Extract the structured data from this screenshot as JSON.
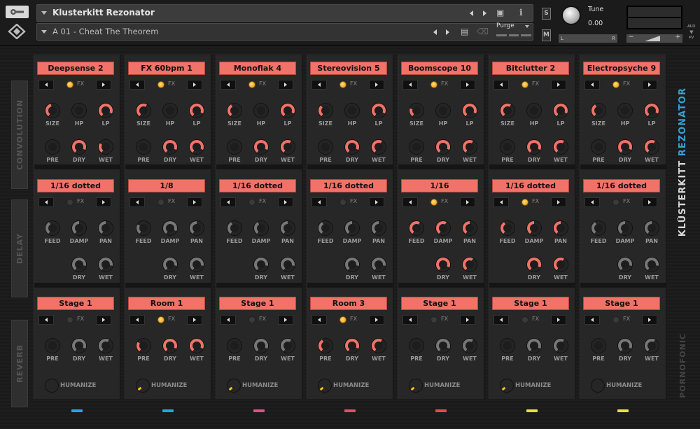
{
  "instrument": {
    "title": "Klusterkitt Rezonator",
    "preset": "A 01 - Cheat The Theorem"
  },
  "header": {
    "purge_label": "Purge",
    "solo_label": "S",
    "mute_label": "M",
    "tune_label": "Tune",
    "tune_value": "0.00",
    "pan_left": "L",
    "pan_right": "R",
    "vol_minus": "−",
    "vol_plus": "+",
    "aux_label": "AUX",
    "pv_label": "PV"
  },
  "section_labels": [
    "CONVOLUTION",
    "DELAY",
    "REVERB"
  ],
  "brand": {
    "product_a": "KLÜSTERKITT",
    "product_b": "REZONATOR",
    "vendor": "PORNOFONIC"
  },
  "fx_label": "FX",
  "knob_labels": {
    "size": "SIZE",
    "hp": "HP",
    "lp": "LP",
    "pre": "PRE",
    "dry": "DRY",
    "wet": "WET",
    "feed": "FEED",
    "damp": "DAMP",
    "pan": "PAN"
  },
  "humanize_label": "HUMANIZE",
  "colors": {
    "accent": "#f07268",
    "knob_active": "#f07268",
    "knob_inactive": "#777777",
    "led_on": "#f2a825",
    "brand_blue": "#3a9fd0"
  },
  "columns": [
    {
      "conv": {
        "name": "Deepsense 2",
        "fx": true,
        "size": 0.45,
        "hp": 0.0,
        "lp": 0.9,
        "pre": 0.0,
        "dry": 0.9,
        "wet": 0.3
      },
      "delay": {
        "name": "1/16 dotted",
        "fx": false,
        "active": false,
        "feed": 0.4,
        "damp": 0.5,
        "pan": 0.5,
        "dry": 0.0,
        "wet": 0.0
      },
      "reverb": {
        "name": "Stage 1",
        "fx": false,
        "active": false,
        "pre": 0.0,
        "dry": 0.9,
        "wet": 0.6
      },
      "humanize": 0.0,
      "indicator": "#1fa8e0"
    },
    {
      "conv": {
        "name": "FX 60bpm 1",
        "fx": true,
        "size": 0.6,
        "hp": 0.0,
        "lp": 0.9,
        "pre": 0.0,
        "dry": 0.9,
        "wet": 0.9
      },
      "delay": {
        "name": "1/8",
        "fx": false,
        "active": false,
        "feed": 0.3,
        "damp": 0.9,
        "pan": 0.5,
        "dry": 0.0,
        "wet": 0.0
      },
      "reverb": {
        "name": "Room 1",
        "fx": true,
        "active": true,
        "pre": 0.3,
        "dry": 0.9,
        "wet": 0.9
      },
      "humanize": 0.3,
      "indicator": "#1fa8e0"
    },
    {
      "conv": {
        "name": "Monoflak 4",
        "fx": true,
        "size": 0.4,
        "hp": 0.0,
        "lp": 0.9,
        "pre": 0.0,
        "dry": 0.9,
        "wet": 0.6
      },
      "delay": {
        "name": "1/16 dotted",
        "fx": false,
        "active": false,
        "feed": 0.4,
        "damp": 0.4,
        "pan": 0.5,
        "dry": 0.0,
        "wet": 0.0
      },
      "reverb": {
        "name": "Stage 1",
        "fx": false,
        "active": false,
        "pre": 0.0,
        "dry": 0.9,
        "wet": 0.6
      },
      "humanize": 0.3,
      "indicator": "#e84a8a"
    },
    {
      "conv": {
        "name": "Stereovision 5",
        "fx": true,
        "size": 0.35,
        "hp": 0.0,
        "lp": 0.9,
        "pre": 0.0,
        "dry": 0.9,
        "wet": 0.6
      },
      "delay": {
        "name": "1/16 dotted",
        "fx": false,
        "active": false,
        "feed": 0.4,
        "damp": 0.5,
        "pan": 0.5,
        "dry": 0.0,
        "wet": 0.0
      },
      "reverb": {
        "name": "Room 3",
        "fx": true,
        "active": true,
        "pre": 0.4,
        "dry": 0.9,
        "wet": 0.6
      },
      "humanize": 0.3,
      "indicator": "#e84a6a"
    },
    {
      "conv": {
        "name": "Boomscope 10",
        "fx": true,
        "size": 0.25,
        "hp": 0.0,
        "lp": 0.9,
        "pre": 0.0,
        "dry": 0.9,
        "wet": 0.6
      },
      "delay": {
        "name": "1/16",
        "fx": true,
        "active": true,
        "feed": 0.6,
        "damp": 0.6,
        "pan": 0.5,
        "dry": 0.9,
        "wet": 0.6
      },
      "reverb": {
        "name": "Stage 1",
        "fx": false,
        "active": false,
        "pre": 0.0,
        "dry": 0.9,
        "wet": 0.6
      },
      "humanize": 0.3,
      "indicator": "#e84a4a"
    },
    {
      "conv": {
        "name": "Bitclutter 2",
        "fx": true,
        "size": 0.6,
        "hp": 0.0,
        "lp": 0.9,
        "pre": 0.0,
        "dry": 0.9,
        "wet": 0.6
      },
      "delay": {
        "name": "1/16 dotted",
        "fx": true,
        "active": true,
        "feed": 0.4,
        "damp": 0.5,
        "pan": 0.5,
        "dry": 0.9,
        "wet": 0.6
      },
      "reverb": {
        "name": "Stage 1",
        "fx": false,
        "active": false,
        "pre": 0.0,
        "dry": 0.9,
        "wet": 0.6
      },
      "humanize": 0.3,
      "indicator": "#e6e23a"
    },
    {
      "conv": {
        "name": "Electropsyche 9",
        "fx": true,
        "size": 0.4,
        "hp": 0.0,
        "lp": 0.9,
        "pre": 0.0,
        "dry": 0.9,
        "wet": 0.6
      },
      "delay": {
        "name": "1/16 dotted",
        "fx": false,
        "active": false,
        "feed": 0.4,
        "damp": 0.5,
        "pan": 0.5,
        "dry": 0.0,
        "wet": 0.0
      },
      "reverb": {
        "name": "Stage 1",
        "fx": false,
        "active": false,
        "pre": 0.0,
        "dry": 0.9,
        "wet": 0.6
      },
      "humanize": 0.0,
      "indicator": "#e6e23a"
    }
  ]
}
